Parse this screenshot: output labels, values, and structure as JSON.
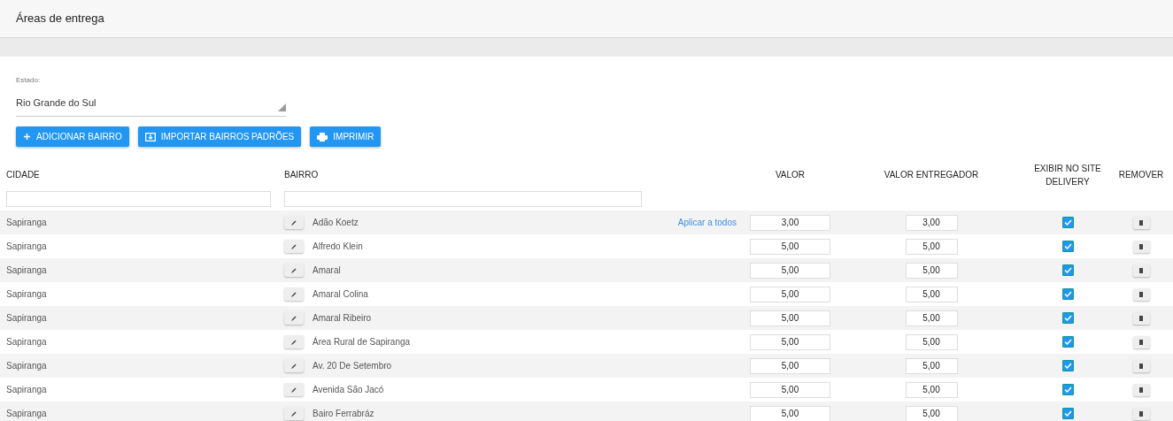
{
  "page": {
    "title": "Áreas de entrega"
  },
  "estado": {
    "label": "Estado:",
    "value": "Rio Grande do Sul"
  },
  "buttons": [
    {
      "kind": "add",
      "label": "ADICIONAR BAIRRO"
    },
    {
      "kind": "import",
      "label": "IMPORTAR BAIRROS PADRÕES"
    },
    {
      "kind": "print",
      "label": "IMPRIMIR"
    }
  ],
  "table": {
    "columns": [
      "CIDADE",
      "BAIRRO",
      "VALOR",
      "VALOR ENTREGADOR",
      "EXIBIR NO SITE DELIVERY",
      "REMOVER"
    ],
    "rows": [
      {
        "cidade": "Sapiranga",
        "bairro": "Adão Koetz",
        "apply_link": "Aplicar a todos",
        "valor": "3,00",
        "valor_entregador": "3,00",
        "checked": true
      },
      {
        "cidade": "Sapiranga",
        "bairro": "Alfredo Klein",
        "valor": "5,00",
        "valor_entregador": "5,00",
        "checked": true
      },
      {
        "cidade": "Sapiranga",
        "bairro": "Amaral",
        "valor": "5,00",
        "valor_entregador": "5,00",
        "checked": true
      },
      {
        "cidade": "Sapiranga",
        "bairro": "Amaral Colina",
        "valor": "5,00",
        "valor_entregador": "5,00",
        "checked": true
      },
      {
        "cidade": "Sapiranga",
        "bairro": "Amaral Ribeiro",
        "valor": "5,00",
        "valor_entregador": "5,00",
        "checked": true
      },
      {
        "cidade": "Sapiranga",
        "bairro": "Área Rural de Sapiranga",
        "valor": "5,00",
        "valor_entregador": "5,00",
        "checked": true
      },
      {
        "cidade": "Sapiranga",
        "bairro": "Av. 20 De Setembro",
        "valor": "5,00",
        "valor_entregador": "5,00",
        "checked": true
      },
      {
        "cidade": "Sapiranga",
        "bairro": "Avenida São Jacó",
        "valor": "5,00",
        "valor_entregador": "5,00",
        "checked": true
      },
      {
        "cidade": "Sapiranga",
        "bairro": "Bairo Ferrabráz",
        "valor": "5,00",
        "valor_entregador": "5,00",
        "checked": true
      }
    ]
  }
}
